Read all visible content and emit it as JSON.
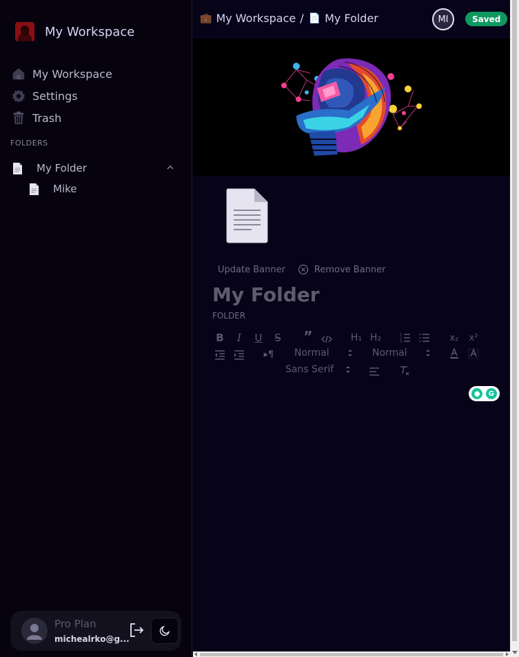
{
  "sidebar": {
    "workspace_name": "My Workspace",
    "nav": [
      {
        "label": "My Workspace",
        "icon": "home-icon"
      },
      {
        "label": "Settings",
        "icon": "gear-icon"
      },
      {
        "label": "Trash",
        "icon": "trash-icon"
      }
    ],
    "folders_title": "FOLDERS",
    "folder": {
      "label": "My Folder",
      "expanded": true
    },
    "files": [
      {
        "label": "Mike"
      }
    ],
    "user": {
      "plan": "Pro Plan",
      "email": "michealrko@g..."
    }
  },
  "header": {
    "breadcrumb": [
      {
        "emoji": "💼",
        "label": "My Workspace"
      },
      {
        "emoji": "📄",
        "label": "My Folder"
      }
    ],
    "separator": "/",
    "avatar_initials": "MI",
    "status": "Saved"
  },
  "page": {
    "update_banner": "Update Banner",
    "remove_banner": "Remove Banner",
    "title": "My Folder",
    "subtitle": "FOLDER"
  },
  "toolbar": {
    "header_select": "Normal",
    "size_select": "Normal",
    "font_select": "Sans Serif"
  },
  "colors": {
    "background": "#06030f",
    "main_background": "#07041a",
    "accent_saved": "#0f9960",
    "text": "#bcb9cc"
  }
}
